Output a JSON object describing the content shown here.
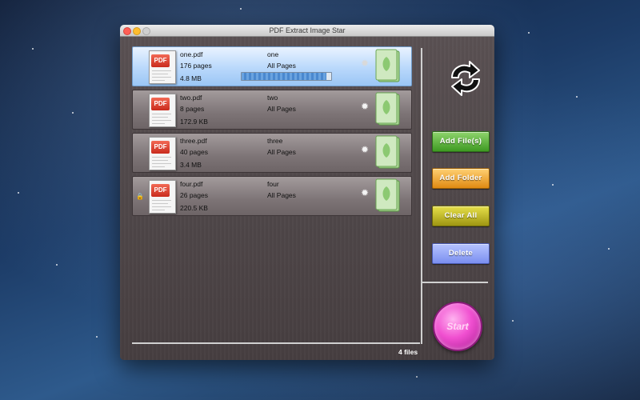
{
  "window": {
    "title": "PDF Extract Image Star"
  },
  "files": [
    {
      "name": "one.pdf",
      "pages": "176 pages",
      "size": "4.8 MB",
      "output": "one",
      "range": "All Pages",
      "selected": true,
      "progress": 0.95,
      "locked": false
    },
    {
      "name": "two.pdf",
      "pages": "8 pages",
      "size": "172.9 KB",
      "output": "two",
      "range": "All Pages",
      "selected": false,
      "locked": false
    },
    {
      "name": "three.pdf",
      "pages": "40 pages",
      "size": "3.4 MB",
      "output": "three",
      "range": "All Pages",
      "selected": false,
      "locked": false
    },
    {
      "name": "four.pdf",
      "pages": "26 pages",
      "size": "220.5 KB",
      "output": "four",
      "range": "All Pages",
      "selected": false,
      "locked": true
    }
  ],
  "icons": {
    "file": "pdf-file-icon",
    "settings": "gear-icon",
    "output": "green-book-icon",
    "lock": "lock-icon",
    "refresh": "refresh-arrows-icon"
  },
  "sidebar": {
    "add_files": "Add File(s)",
    "add_folder": "Add Folder",
    "clear_all": "Clear All",
    "delete": "Delete",
    "start": "Start"
  },
  "status": {
    "file_count": "4 files"
  },
  "colors": {
    "add": "#4fae2c",
    "folder": "#f0a020",
    "clear": "#c2bb1c",
    "delete": "#8c9ef5",
    "start": "#f04fd0"
  }
}
